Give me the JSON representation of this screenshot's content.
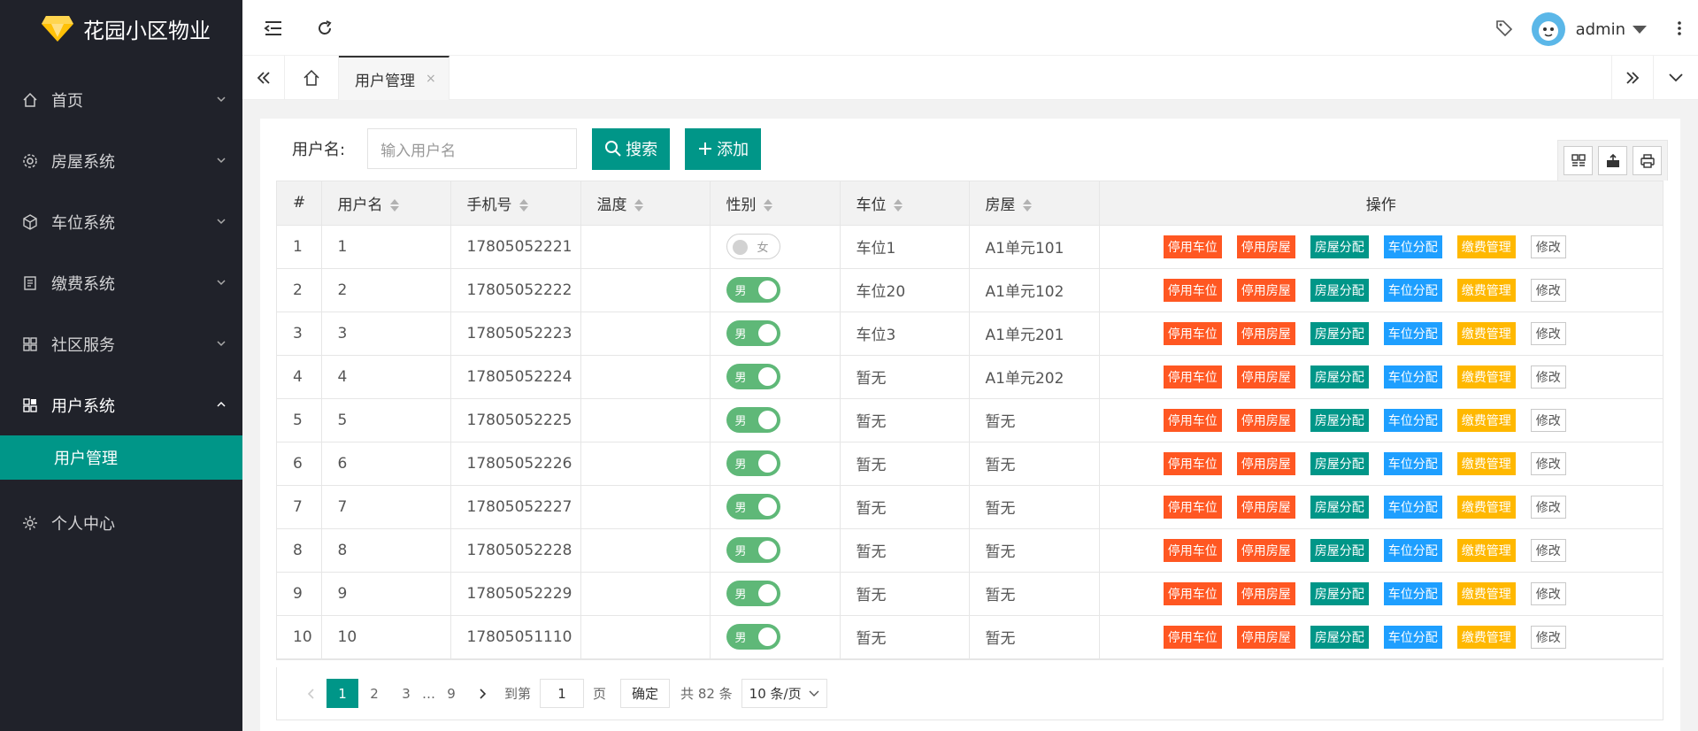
{
  "app": {
    "title": "花园小区物业"
  },
  "sidebar": {
    "items": [
      {
        "label": "首页",
        "icon": "home-icon"
      },
      {
        "label": "房屋系统",
        "icon": "gear-icon"
      },
      {
        "label": "车位系统",
        "icon": "cube-icon"
      },
      {
        "label": "缴费系统",
        "icon": "receipt-icon"
      },
      {
        "label": "社区服务",
        "icon": "apps-icon"
      },
      {
        "label": "用户系统",
        "icon": "apps-icon"
      }
    ],
    "sub_item": "用户管理",
    "last_item": "个人中心"
  },
  "header": {
    "user": "admin"
  },
  "tabs": {
    "active": "用户管理",
    "close": "×"
  },
  "search": {
    "label": "用户名:",
    "placeholder": "输入用户名",
    "search_button": "搜索",
    "add_button": "添加"
  },
  "table": {
    "columns": [
      "#",
      "用户名",
      "手机号",
      "温度",
      "性别",
      "车位",
      "房屋",
      "操作"
    ],
    "rows": [
      {
        "idx": "1",
        "name": "1",
        "phone": "17805052221",
        "temp": "",
        "gender": "女",
        "gender_on": false,
        "parking": "车位1",
        "house": "A1单元101"
      },
      {
        "idx": "2",
        "name": "2",
        "phone": "17805052222",
        "temp": "",
        "gender": "男",
        "gender_on": true,
        "parking": "车位20",
        "house": "A1单元102"
      },
      {
        "idx": "3",
        "name": "3",
        "phone": "17805052223",
        "temp": "",
        "gender": "男",
        "gender_on": true,
        "parking": "车位3",
        "house": "A1单元201"
      },
      {
        "idx": "4",
        "name": "4",
        "phone": "17805052224",
        "temp": "",
        "gender": "男",
        "gender_on": true,
        "parking": "暂无",
        "house": "A1单元202"
      },
      {
        "idx": "5",
        "name": "5",
        "phone": "17805052225",
        "temp": "",
        "gender": "男",
        "gender_on": true,
        "parking": "暂无",
        "house": "暂无"
      },
      {
        "idx": "6",
        "name": "6",
        "phone": "17805052226",
        "temp": "",
        "gender": "男",
        "gender_on": true,
        "parking": "暂无",
        "house": "暂无"
      },
      {
        "idx": "7",
        "name": "7",
        "phone": "17805052227",
        "temp": "",
        "gender": "男",
        "gender_on": true,
        "parking": "暂无",
        "house": "暂无"
      },
      {
        "idx": "8",
        "name": "8",
        "phone": "17805052228",
        "temp": "",
        "gender": "男",
        "gender_on": true,
        "parking": "暂无",
        "house": "暂无"
      },
      {
        "idx": "9",
        "name": "9",
        "phone": "17805052229",
        "temp": "",
        "gender": "男",
        "gender_on": true,
        "parking": "暂无",
        "house": "暂无"
      },
      {
        "idx": "10",
        "name": "10",
        "phone": "17805051110",
        "temp": "",
        "gender": "男",
        "gender_on": true,
        "parking": "暂无",
        "house": "暂无"
      }
    ],
    "actions": [
      {
        "label": "停用车位",
        "style": "red"
      },
      {
        "label": "停用房屋",
        "style": "red"
      },
      {
        "label": "房屋分配",
        "style": "teal"
      },
      {
        "label": "车位分配",
        "style": "blue"
      },
      {
        "label": "缴费管理",
        "style": "yel"
      },
      {
        "label": "修改",
        "style": "plain"
      }
    ]
  },
  "pagination": {
    "pages": [
      "1",
      "2",
      "3"
    ],
    "ellipsis": "…",
    "last_page": "9",
    "current": "1",
    "goto_label": "到第",
    "goto_value": "1",
    "page_unit": "页",
    "confirm": "确定",
    "total": "共 82 条",
    "per_page": "10 条/页"
  },
  "colors": {
    "sidebar_bg": "#20222a",
    "accent": "#009688",
    "danger": "#ff5722",
    "info": "#1e9fff",
    "warn": "#ffb800",
    "switch_on": "#5fb878"
  }
}
